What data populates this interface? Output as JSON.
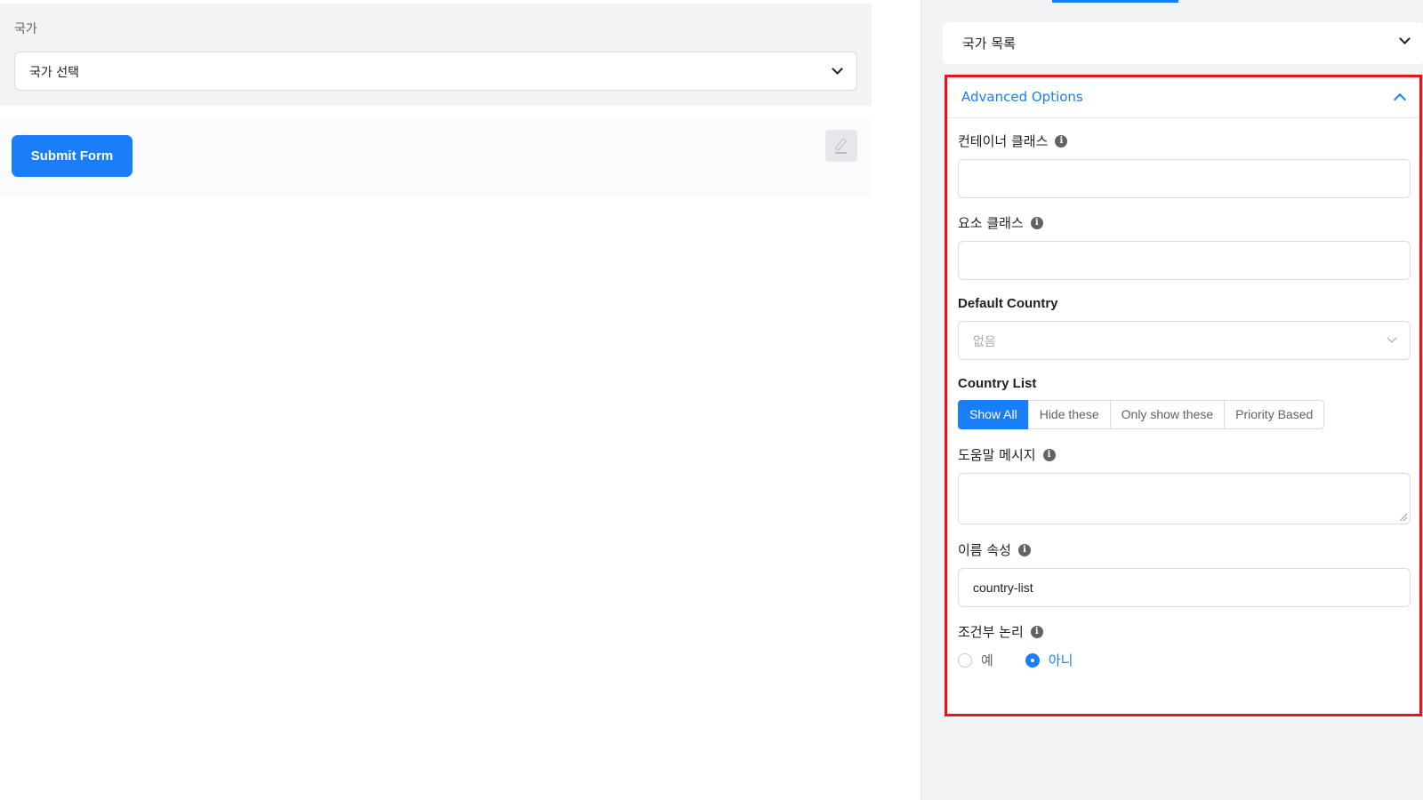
{
  "preview": {
    "field_label": "국가",
    "select_value": "국가 선택",
    "submit_label": "Submit Form"
  },
  "sidebar": {
    "collapsed_section_title": "국가 목록",
    "advanced": {
      "title": "Advanced Options",
      "container_class_label": "컨테이너 클래스",
      "container_class_value": "",
      "element_class_label": "요소 클래스",
      "element_class_value": "",
      "default_country_label": "Default Country",
      "default_country_value": "없음",
      "country_list_label": "Country List",
      "country_list_options": [
        "Show All",
        "Hide these",
        "Only show these",
        "Priority Based"
      ],
      "country_list_selected": "Show All",
      "help_message_label": "도움말 메시지",
      "help_message_value": "",
      "name_attr_label": "이름 속성",
      "name_attr_value": "country-list",
      "conditional_logic_label": "조건부 논리",
      "conditional_yes": "예",
      "conditional_no": "아니",
      "conditional_selected": "아니"
    }
  },
  "colors": {
    "primary": "#1a7efb",
    "highlight_border": "#e8131b"
  }
}
